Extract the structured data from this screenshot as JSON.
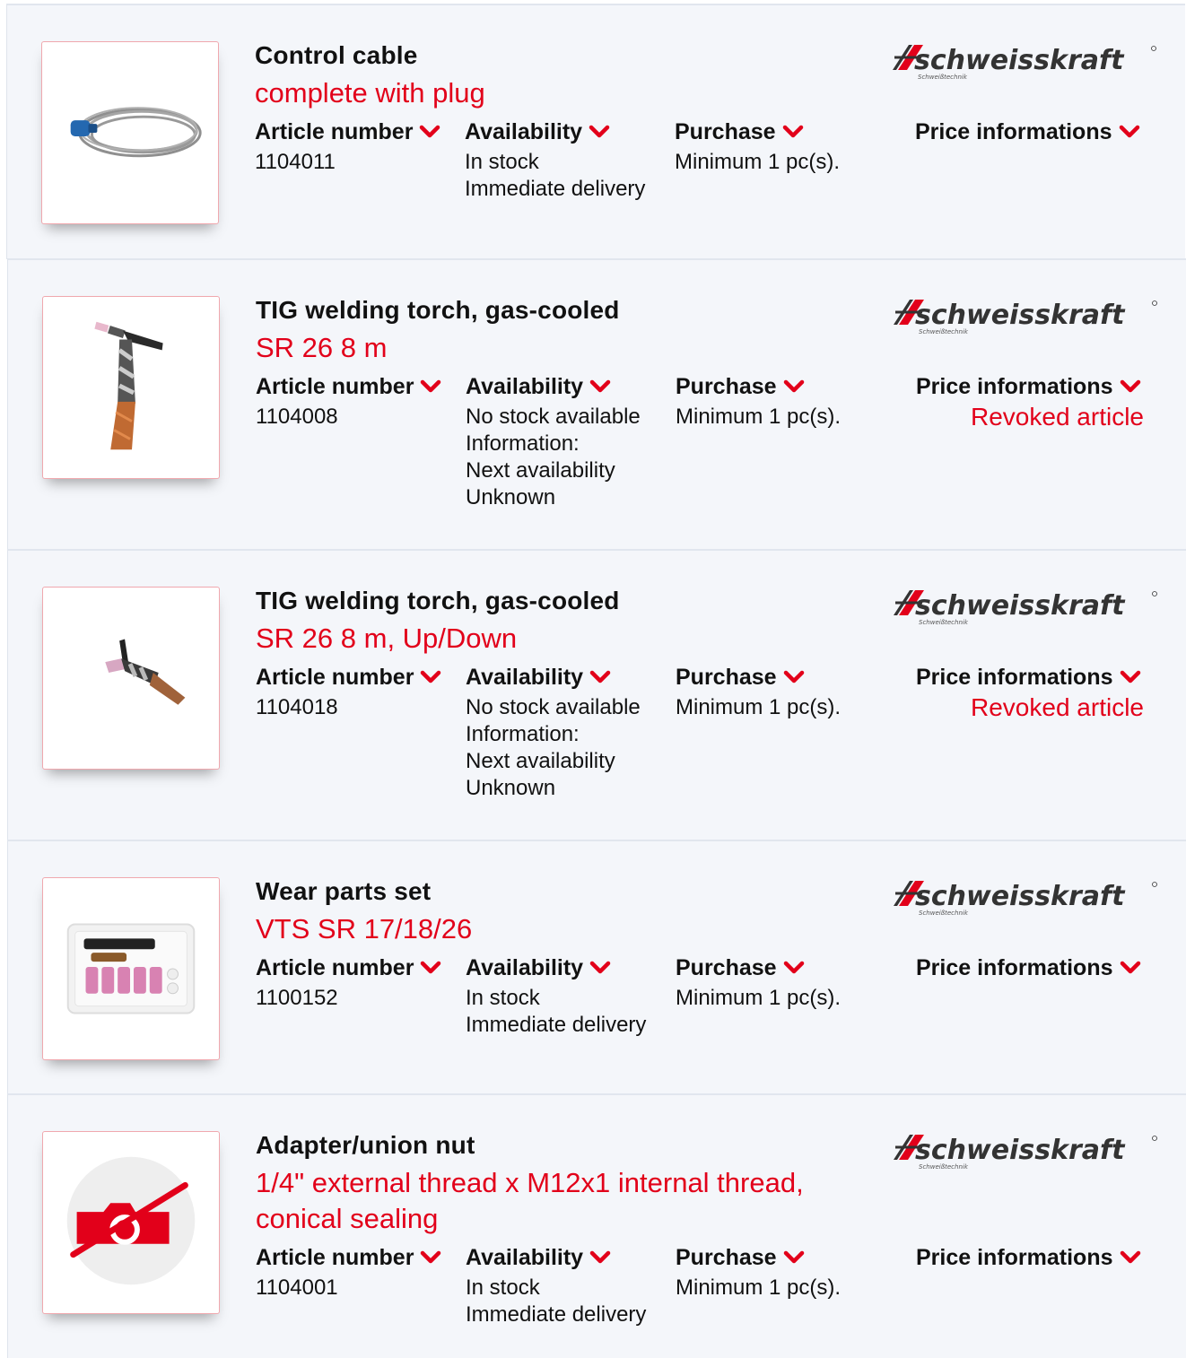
{
  "colors": {
    "accent": "#e2001a",
    "row_bg": "#f4f6fa"
  },
  "labels": {
    "article_number": "Article number",
    "availability": "Availability",
    "purchase": "Purchase",
    "price_informations": "Price informations"
  },
  "brand": {
    "name": "schweisskraft",
    "tagline": "Schweißtechnik"
  },
  "products": [
    {
      "title": "Control cable",
      "subtitle": "complete with plug",
      "article_number": "1104011",
      "availability": [
        "In stock",
        "Immediate delivery"
      ],
      "purchase": "Minimum 1 pc(s).",
      "price_note": "",
      "image": "control-cable-image"
    },
    {
      "title": "TIG welding torch, gas-cooled",
      "subtitle": "SR 26 8 m",
      "article_number": "1104008",
      "availability": [
        "No stock available",
        "Information:",
        "Next availability",
        "Unknown"
      ],
      "purchase": "Minimum 1 pc(s).",
      "price_note": "Revoked article",
      "image": "tig-torch-image"
    },
    {
      "title": "TIG welding torch, gas-cooled",
      "subtitle": "SR 26 8 m, Up/Down",
      "article_number": "1104018",
      "availability": [
        "No stock available",
        "Information:",
        "Next availability",
        "Unknown"
      ],
      "purchase": "Minimum 1 pc(s).",
      "price_note": "Revoked article",
      "image": "tig-torch-updown-image"
    },
    {
      "title": "Wear parts set",
      "subtitle": "VTS SR 17/18/26",
      "article_number": "1100152",
      "availability": [
        "In stock",
        "Immediate delivery"
      ],
      "purchase": "Minimum 1 pc(s).",
      "price_note": "",
      "image": "wear-parts-set-image"
    },
    {
      "title": "Adapter/union nut",
      "subtitle": "1/4\" external thread x M12x1 internal thread, conical sealing",
      "article_number": "1104001",
      "availability": [
        "In stock",
        "Immediate delivery"
      ],
      "purchase": "Minimum 1 pc(s).",
      "price_note": "",
      "image": "no-image-placeholder"
    }
  ]
}
